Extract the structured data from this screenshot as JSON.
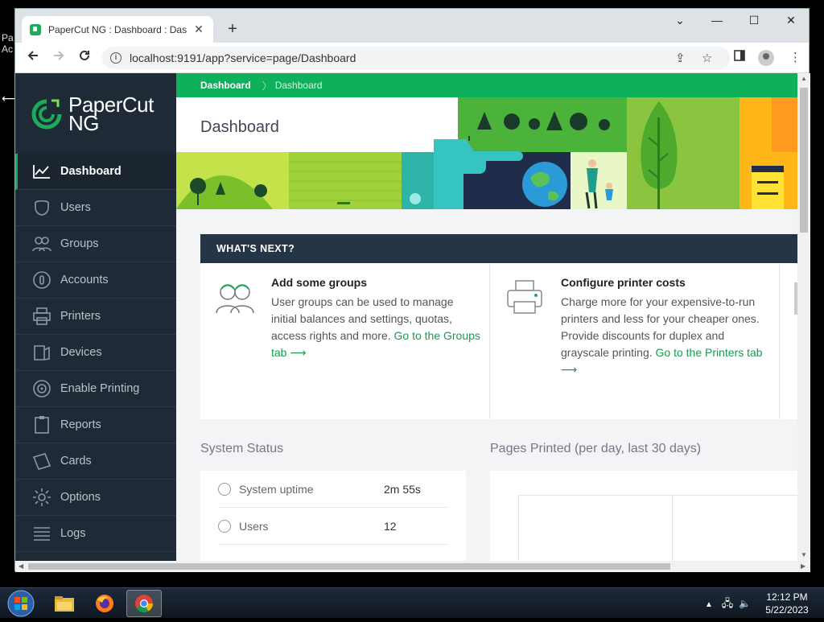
{
  "desktop": {
    "fragment_lines": [
      "Pa",
      "Ac"
    ]
  },
  "browser": {
    "tab_title": "PaperCut NG : Dashboard : Dash",
    "tab_close": "✕",
    "new_tab": "+",
    "url": "localhost:9191/app?service=page/Dashboard",
    "window_controls": [
      "⌄",
      "—",
      "☐",
      "✕"
    ]
  },
  "app": {
    "logo_line1": "PaperCut",
    "logo_line2": "NG",
    "nav": [
      {
        "label": "Dashboard",
        "icon": "chart-line-icon",
        "active": true
      },
      {
        "label": "Users",
        "icon": "user-icon"
      },
      {
        "label": "Groups",
        "icon": "groups-icon"
      },
      {
        "label": "Accounts",
        "icon": "accounts-icon"
      },
      {
        "label": "Printers",
        "icon": "printer-icon"
      },
      {
        "label": "Devices",
        "icon": "devices-icon"
      },
      {
        "label": "Enable Printing",
        "icon": "enable-printing-icon"
      },
      {
        "label": "Reports",
        "icon": "reports-icon"
      },
      {
        "label": "Cards",
        "icon": "cards-icon"
      },
      {
        "label": "Options",
        "icon": "gear-icon"
      },
      {
        "label": "Logs",
        "icon": "logs-icon"
      }
    ],
    "breadcrumb": [
      "Dashboard",
      "Dashboard"
    ],
    "page_title": "Dashboard",
    "whats_next": {
      "heading": "WHAT'S NEXT?",
      "items": [
        {
          "title": "Add some groups",
          "body": "User groups can be used to manage initial balances and settings, quotas, access rights and more. ",
          "link": "Go to the Groups tab ⟶"
        },
        {
          "title": "Configure printer costs",
          "body": "Charge more for your expensive-to-run printers and less for your cheaper ones. Provide discounts for duplex and grayscale printing. ",
          "link": "Go to the Printers tab ⟶"
        }
      ]
    },
    "system_status": {
      "title": "System Status",
      "rows": [
        {
          "label": "System uptime",
          "value": "2m 55s"
        },
        {
          "label": "Users",
          "value": "12"
        }
      ]
    },
    "pages_printed": {
      "title": "Pages Printed (per day, last 30 days)"
    }
  },
  "taskbar": {
    "time": "12:12 PM",
    "date": "5/22/2023"
  },
  "colors": {
    "brand_green": "#0fb05c",
    "sidebar": "#1e2a36",
    "section_header": "#233546"
  }
}
